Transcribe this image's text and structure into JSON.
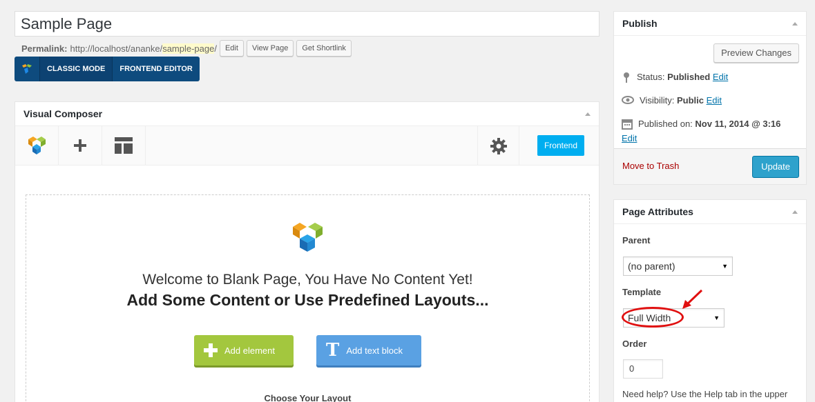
{
  "post": {
    "title": "Sample Page",
    "permalink_label": "Permalink:",
    "permalink_base": "http://localhost/ananke/",
    "permalink_slug": "sample-page",
    "permalink_tail": "/",
    "edit_btn": "Edit",
    "view_btn": "View Page",
    "shortlink_btn": "Get Shortlink"
  },
  "mode_bar": {
    "classic": "CLASSIC MODE",
    "frontend": "FRONTEND EDITOR"
  },
  "vc": {
    "title": "Visual Composer",
    "frontend_btn": "Frontend",
    "welcome_line1": "Welcome to Blank Page, You Have No Content Yet!",
    "welcome_line2": "Add Some Content or Use Predefined Layouts...",
    "add_element": "Add element",
    "add_text_block": "Add text block",
    "choose_layout": "Choose Your Layout"
  },
  "publish": {
    "title": "Publish",
    "preview_btn": "Preview Changes",
    "status_label": "Status:",
    "status_value": "Published",
    "visibility_label": "Visibility:",
    "visibility_value": "Public",
    "published_label": "Published on:",
    "published_value": "Nov 11, 2014 @ 3:16",
    "edit_link": "Edit",
    "trash": "Move to Trash",
    "update_btn": "Update"
  },
  "attributes": {
    "title": "Page Attributes",
    "parent_label": "Parent",
    "parent_value": "(no parent)",
    "template_label": "Template",
    "template_value": "Full Width",
    "order_label": "Order",
    "order_value": "0",
    "help_text": "Need help? Use the Help tab in the upper"
  },
  "colors": {
    "accent": "#0e4b7e",
    "vc_frontend": "#00aef0",
    "add_element": "#a3c73e",
    "add_text": "#5aa1e3",
    "update": "#2ea2cc",
    "annotation": "#e01010"
  }
}
